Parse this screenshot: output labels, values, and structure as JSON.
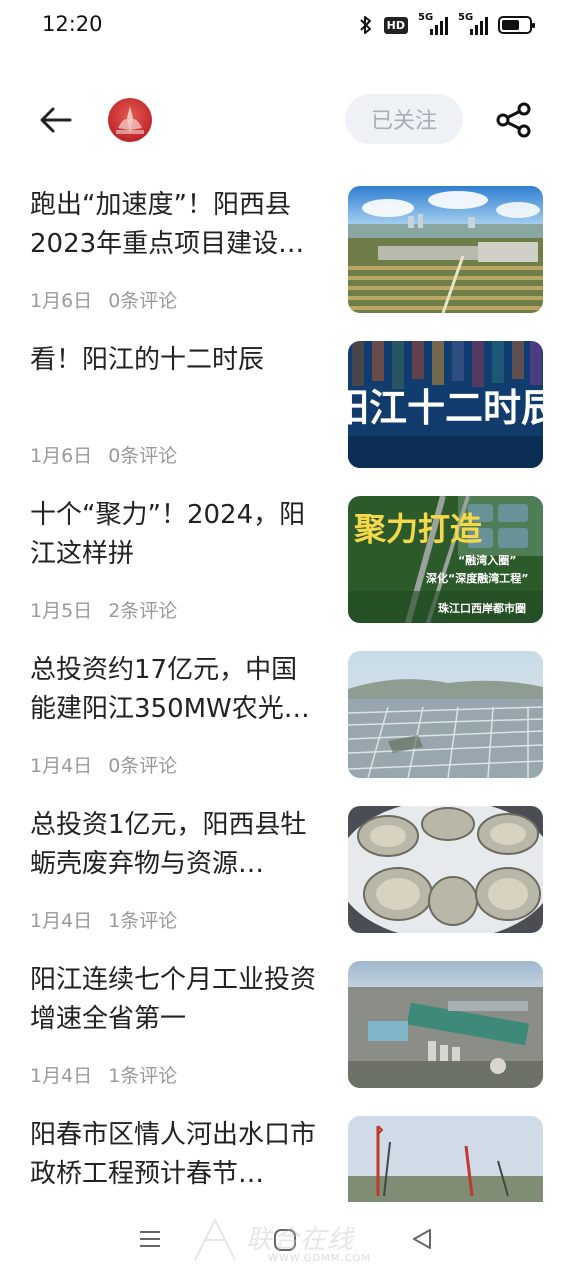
{
  "status_bar": {
    "time": "12:20",
    "icons": [
      "bluetooth-icon",
      "hd-icon",
      "signal-5g-icon",
      "signal-5g-icon",
      "battery-icon"
    ],
    "hd_label": "HD",
    "network_label_1": "5G",
    "network_label_2": "5G"
  },
  "header": {
    "follow_label": "已关注",
    "back_icon": "arrow-left-icon",
    "share_icon": "share-icon"
  },
  "articles": [
    {
      "title": "跑出“加速度”！阳西县2023年重点项目建设…",
      "date": "1月6日",
      "comments": "0条评论"
    },
    {
      "title": "看！阳江的十二时辰",
      "date": "1月6日",
      "comments": "0条评论"
    },
    {
      "title": "十个“聚力”！2024，阳江这样拼",
      "date": "1月5日",
      "comments": "2条评论"
    },
    {
      "title": "总投资约17亿元，中国能建阳江350MW农光…",
      "date": "1月4日",
      "comments": "0条评论"
    },
    {
      "title": "总投资1亿元，阳西县牡蛎壳废弃物与资源…",
      "date": "1月4日",
      "comments": "1条评论"
    },
    {
      "title": "阳江连续七个月工业投资增速全省第一",
      "date": "1月4日",
      "comments": "1条评论"
    },
    {
      "title": "阳春市区情人河出水口市政桥工程预计春节…",
      "date": "",
      "comments": ""
    }
  ],
  "thumb_texts": {
    "poster_2": "阳江十二时辰",
    "poster_3_big": "聚力打造",
    "poster_3_tag1": "“融湾入圈”",
    "poster_3_tag2": "深化“深度融湾工程”",
    "poster_3_tag3": "珠江口西岸都市圈"
  },
  "navbar": {
    "icons": [
      "menu-icon",
      "home-icon",
      "back-triangle-icon"
    ],
    "watermark_main": "联合在线",
    "watermark_sub": "WWW.GDMM.COM"
  },
  "colors": {
    "accent_red": "#c0282c",
    "follow_bg": "#eef1f6",
    "follow_text": "#a9adb4",
    "meta_text": "#9a9a9a"
  }
}
